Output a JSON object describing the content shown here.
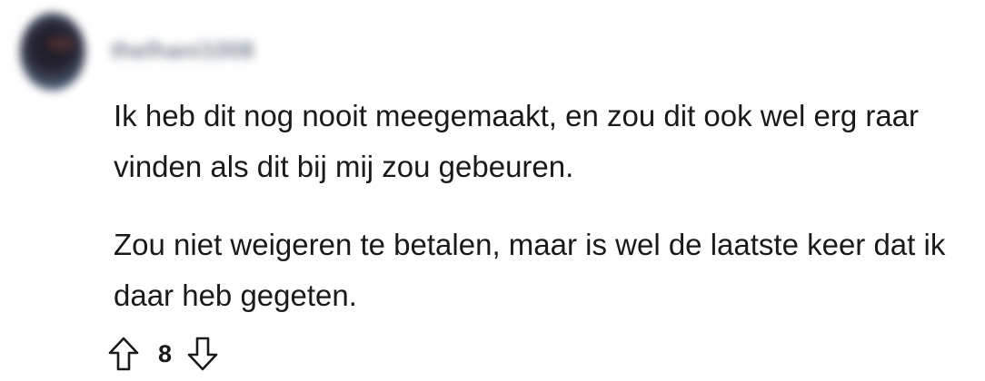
{
  "comment": {
    "username": "thelhani1008",
    "paragraphs": [
      "Ik heb dit nog nooit meegemaakt, en zou dit ook wel erg raar vinden als dit bij mij zou gebeuren.",
      "Zou niet weigeren te betalen, maar is wel de laatste keer dat ik daar heb gegeten."
    ],
    "score": "8"
  },
  "icons": {
    "upvote": "upvote-arrow-icon",
    "downvote": "downvote-arrow-icon"
  },
  "colors": {
    "text": "#1a1a1b",
    "username_blurred": "#7f8a95"
  }
}
